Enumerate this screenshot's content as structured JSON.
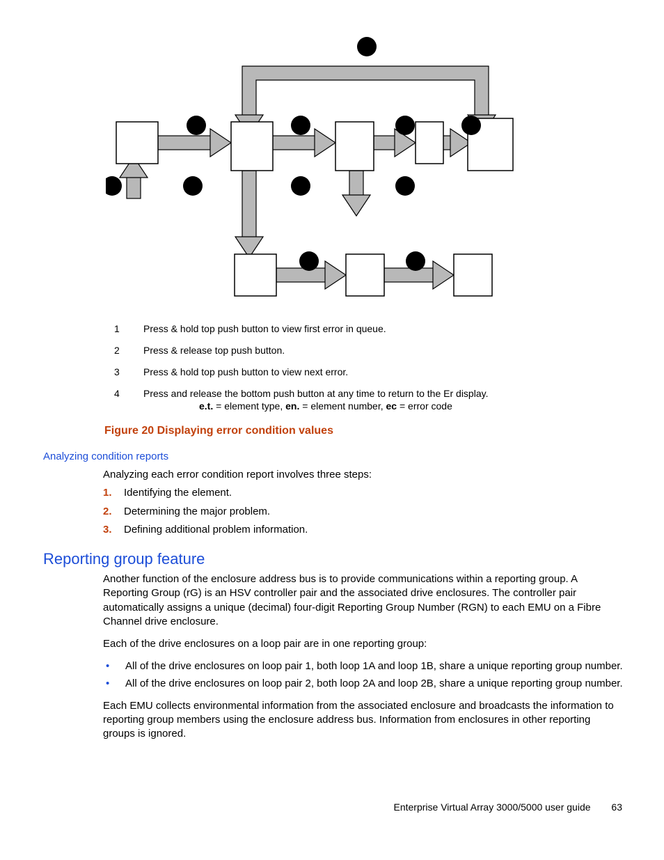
{
  "steps": [
    {
      "n": "1",
      "text": "Press & hold top push button to view first error in queue."
    },
    {
      "n": "2",
      "text": "Press & release top push button."
    },
    {
      "n": "3",
      "text": "Press & hold top push button to view next error."
    },
    {
      "n": "4",
      "text": "Press and release the bottom push button at any time to return to the Er display."
    }
  ],
  "abbr": {
    "et_b": "e.t.",
    "et_t": " = element type, ",
    "en_b": "en.",
    "en_t": " = element number, ",
    "ec_b": "ec",
    "ec_t": " = error code"
  },
  "figure_caption": "Figure 20 Displaying error condition values",
  "sub_heading": "Analyzing condition reports",
  "intro1": "Analyzing each error condition report involves three steps:",
  "analysis_steps": [
    "Identifying the element.",
    "Determining the major problem.",
    "Defining additional problem information."
  ],
  "h2": "Reporting group feature",
  "para1": "Another function of the enclosure address bus is to provide communications within a reporting group. A Reporting Group (rG) is an HSV controller pair and the associated drive enclosures. The controller pair automatically assigns a unique (decimal) four-digit Reporting Group Number (RGN) to each EMU on a Fibre Channel drive enclosure.",
  "para2": "Each of the drive enclosures on a loop pair are in one reporting group:",
  "bullets": [
    "All of the drive enclosures on loop pair 1, both loop 1A and loop 1B, share a unique reporting group number.",
    "All of the drive enclosures on loop pair 2, both loop 2A and loop 2B, share a unique reporting group number."
  ],
  "para3": "Each EMU collects environmental information from the associated enclosure and broadcasts the information to reporting group members using the enclosure address bus. Information from enclosures in other reporting groups is ignored.",
  "footer_text": "Enterprise Virtual Array 3000/5000 user guide",
  "page_number": "63"
}
